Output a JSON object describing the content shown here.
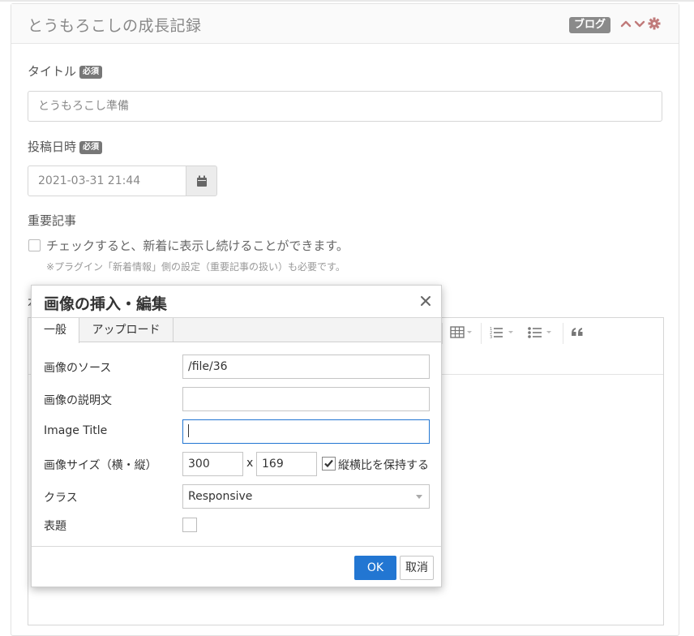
{
  "panel": {
    "title": "とうもろこしの成長記録",
    "badge": "ブログ",
    "icons": [
      "chevron-up-icon",
      "chevron-down-icon",
      "gear-icon"
    ],
    "accent_color": "#c07a7a"
  },
  "form": {
    "title_label": "タイトル",
    "required": "必須",
    "title_value": "とうもろこし準備",
    "date_label": "投稿日時",
    "date_value": "2021-03-31 21:44",
    "important_label": "重要記事",
    "important_check_text": "チェックすると、新着に表示し続けることができます。",
    "important_note": "※プラグイン「新着情報」側の設定（重要記事の扱い）も必要です。",
    "body_label_stub": "本"
  },
  "editor": {
    "toolbar_icons": [
      "table-icon",
      "numbered-list-icon",
      "bullet-list-icon",
      "blockquote-icon"
    ]
  },
  "dialog": {
    "title": "画像の挿入・編集",
    "tabs": [
      {
        "label": "一般"
      },
      {
        "label": "アップロード"
      }
    ],
    "fields": {
      "source_label": "画像のソース",
      "source_value": "/file/36",
      "alt_label": "画像の説明文",
      "alt_value": "",
      "img_title_label": "Image Title",
      "img_title_value": "",
      "size_label": "画像サイズ（横・縦）",
      "width_value": "300",
      "times": "x",
      "height_value": "169",
      "keep_ratio_label": "縦横比を保持する",
      "class_label": "クラス",
      "class_value": "Responsive",
      "caption_label": "表題"
    },
    "ok_label": "OK",
    "cancel_label": "取消",
    "primary_color": "#2276d2"
  }
}
